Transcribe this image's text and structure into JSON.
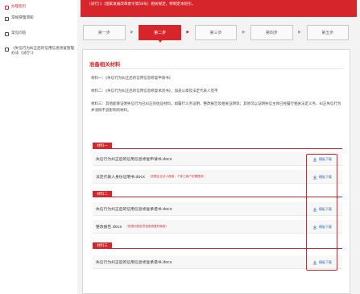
{
  "sidebar": {
    "items": [
      {
        "label": "办理指引",
        "active": true
      },
      {
        "label": "常规受理须知",
        "active": false
      },
      {
        "label": "常见问答",
        "active": false
      },
      {
        "label": "《失信行为纠正后的信用信息修复管理办法（试行）》",
        "active": false
      }
    ]
  },
  "banner": {
    "text": "（试行）》（国家发展改革委令第58号）相关规定，特制定本指引。"
  },
  "steps": [
    "第一步",
    "第二步",
    "第三步",
    "第四步",
    "第五步"
  ],
  "active_step": 1,
  "panel": {
    "title": "准备相关材料",
    "materials": [
      "材料一：《失信行为纠正后的信用信息修复申请书》",
      "材料二：《失信行为纠正后的信用信息修复承诺书》，加盖公章及法定代表人签字",
      "材料三：其他能够证明失信行为已纠正的佐证材料，如履行义务证明、整改报告及相关证明等；其他可以证明失信主体已经履行相关法定义务、纠正失信行为并消除不良影响的材料。"
    ],
    "groups": [
      {
        "tag": "材料一",
        "files": [
          {
            "name": "失信行为纠正后的信用信息修复申请书.docx",
            "note": ""
          },
          {
            "name": "法定代表人身份证明书.docx",
            "note": "（仅限企业法人使用，个体工商户无需提供）"
          }
        ]
      },
      {
        "tag": "材料二",
        "files": [
          {
            "name": "失信行为纠正后的信用信息修复承诺书.docx",
            "note": ""
          },
          {
            "name": "整改报告.docx",
            "note": "（仅限行政处罚信息修复时使用）"
          }
        ]
      },
      {
        "tag": "材料三",
        "files": [
          {
            "name": "失信行为纠正后的信用信息修复承诺书.docx",
            "note": ""
          }
        ]
      }
    ],
    "download_label": "模板下载"
  },
  "colors": {
    "accent": "#d7262b",
    "link": "#2b67b8"
  }
}
